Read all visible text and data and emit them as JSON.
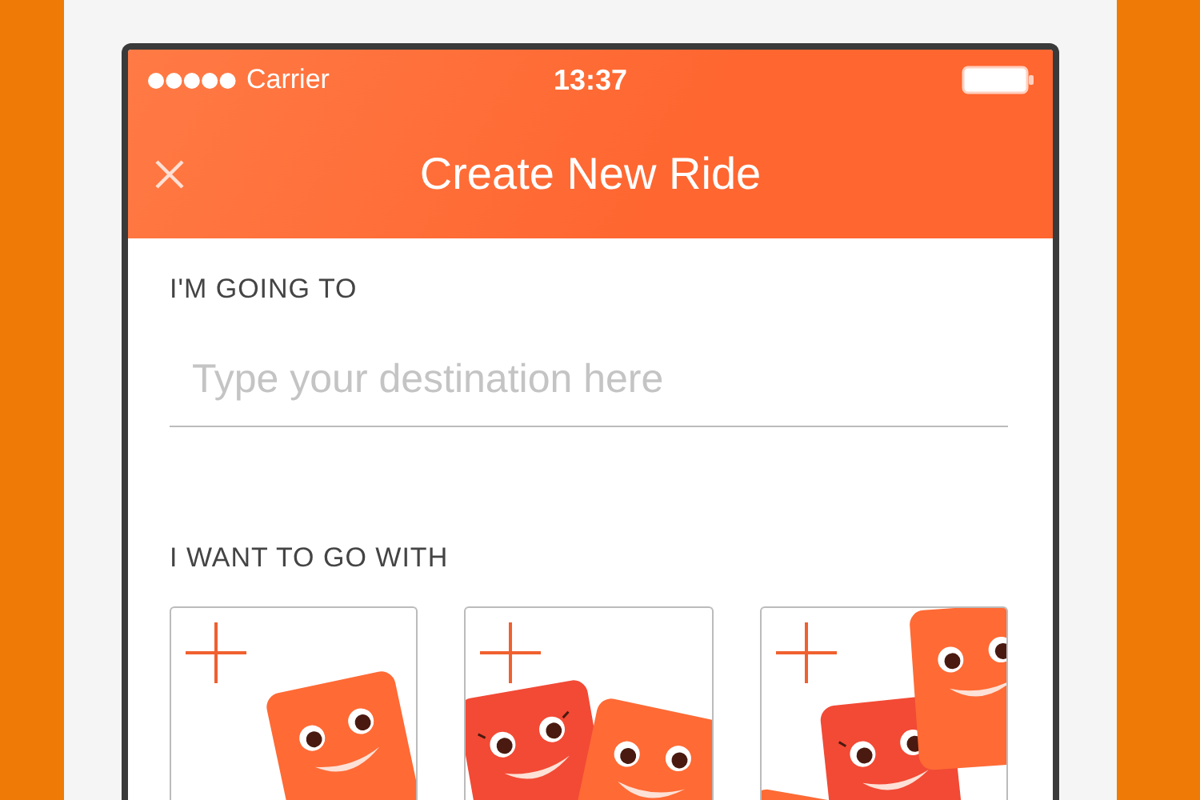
{
  "status_bar": {
    "carrier": "Carrier",
    "time": "13:37"
  },
  "nav_bar": {
    "title": "Create New Ride"
  },
  "destination": {
    "label": "I'M GOING TO",
    "placeholder": "Type your destination here"
  },
  "companions": {
    "label": "I WANT TO GO WITH",
    "options": [
      {
        "kind": "one"
      },
      {
        "kind": "two"
      },
      {
        "kind": "three"
      }
    ]
  }
}
